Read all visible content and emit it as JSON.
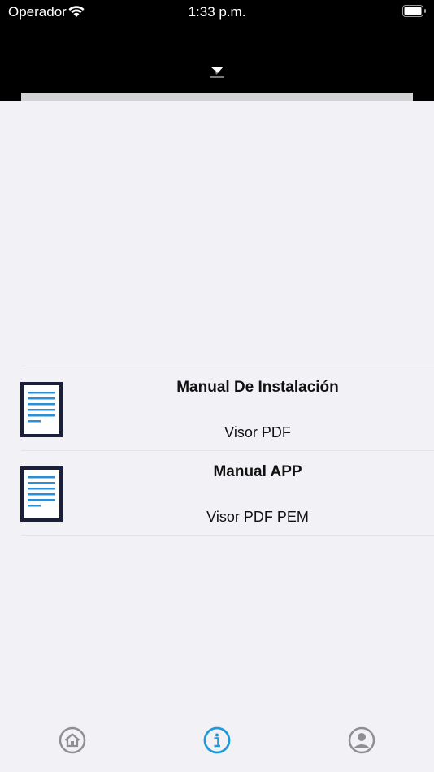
{
  "status_bar": {
    "carrier": "Operador",
    "time": "1:33 p.m."
  },
  "header": {
    "logo_icon": "app-logo-icon"
  },
  "documents": [
    {
      "title": "Manual De Instalación",
      "subtitle": "Visor PDF",
      "icon": "document-icon"
    },
    {
      "title": "Manual APP",
      "subtitle": "Visor PDF PEM",
      "icon": "document-icon"
    }
  ],
  "tab_bar": {
    "items": [
      {
        "icon": "home-icon",
        "active": false
      },
      {
        "icon": "info-icon",
        "active": true
      },
      {
        "icon": "profile-icon",
        "active": false
      }
    ],
    "active_color": "#1e9ad6",
    "inactive_color": "#8e8e93"
  },
  "colors": {
    "header_background": "#000000",
    "page_background": "#f2f1f6",
    "document_frame": "#1a1f3a",
    "document_lines": "#2b8fd6"
  }
}
